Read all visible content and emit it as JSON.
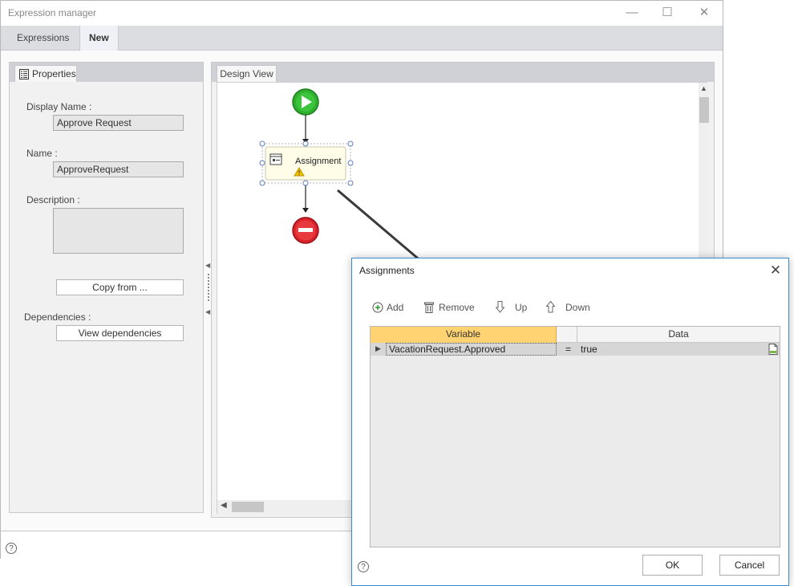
{
  "window": {
    "title": "Expression manager",
    "minimize_glyph": "—",
    "maximize_glyph": "☐",
    "close_glyph": "✕"
  },
  "tabs": [
    {
      "label": "Expressions",
      "active": false
    },
    {
      "label": "New",
      "active": true
    }
  ],
  "properties": {
    "tab_label": "Properties",
    "display_name_label": "Display Name :",
    "display_name_value": "Approve Request",
    "name_label": "Name :",
    "name_value": "ApproveRequest",
    "description_label": "Description :",
    "description_value": "",
    "copy_from_label": "Copy from ...",
    "dependencies_label": "Dependencies :",
    "view_dependencies_label": "View dependencies"
  },
  "design_view": {
    "tab_label": "Design View",
    "assignment_node_label": "Assignment"
  },
  "assignments_dialog": {
    "title": "Assignments",
    "close_glyph": "✕",
    "toolbar": {
      "add_label": "Add",
      "remove_label": "Remove",
      "up_label": "Up",
      "down_label": "Down"
    },
    "columns": {
      "variable": "Variable",
      "data": "Data"
    },
    "rows": [
      {
        "variable": "VacationRequest.Approved",
        "operator": "=",
        "data": "true"
      }
    ],
    "ok_label": "OK",
    "cancel_label": "Cancel"
  },
  "help_glyph": "?",
  "colors": {
    "start_green": "#2fae2f",
    "stop_red": "#d9232a",
    "variable_header_orange": "#ffd272",
    "dialog_border": "#3b8bd3",
    "warning_yellow": "#f3c300"
  }
}
